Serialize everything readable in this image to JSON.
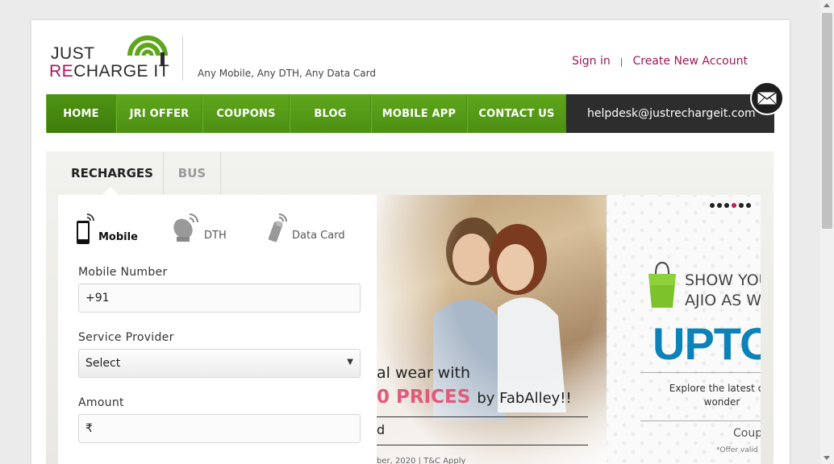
{
  "header": {
    "logo_just": "JUST",
    "logo_re": "RE",
    "logo_charge": "CHARGE IT",
    "tagline": "Any Mobile, Any DTH, Any Data Card",
    "sign_in": "Sign in",
    "separator": "|",
    "create_account": "Create New Account",
    "brand_green": "#5ea61c",
    "brand_magenta": "#b0135a"
  },
  "nav": {
    "items": [
      {
        "label": "HOME"
      },
      {
        "label": "JRI OFFER"
      },
      {
        "label": "COUPONS"
      },
      {
        "label": "BLOG"
      },
      {
        "label": "MOBILE APP"
      },
      {
        "label": "CONTACT US"
      }
    ],
    "helpdesk": "helpdesk@justrechargeit.com"
  },
  "tabs": {
    "recharges": "RECHARGES",
    "bus": "BUS"
  },
  "recharge_types": {
    "mobile": "Mobile",
    "dth": "DTH",
    "datacard": "Data Card"
  },
  "form": {
    "mobile_label": "Mobile Number",
    "mobile_value": "+91",
    "provider_label": "Service Provider",
    "provider_value": "Select",
    "amount_label": "Amount",
    "amount_value": "₹"
  },
  "banner": {
    "line1": "al wear with",
    "line2_highlight": "0 PRICES",
    "line2_rest": "by FabAlley!!",
    "line3": "d",
    "fine_print": "ber, 2020 | T&C Apply"
  },
  "promo": {
    "show_line1": "SHOW YOU",
    "show_line2": "AJIO AS WE",
    "upto": "UPTO",
    "explore_line1": "Explore the latest coll",
    "explore_line2": "wonder",
    "coupon": "Coup",
    "offer": "*Offer valid"
  }
}
